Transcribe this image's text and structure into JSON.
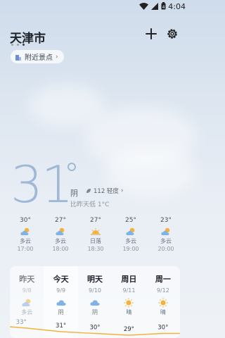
{
  "status": {
    "time": "4:04",
    "battery": "4"
  },
  "header": {
    "city": "天津市",
    "nearby_label": "附近景点"
  },
  "current": {
    "temp": "31",
    "condition": "阴",
    "aqi_label": "112 轻度",
    "compare": "比昨天低 1°C"
  },
  "hourly": [
    {
      "temp": "30°",
      "cond": "多云",
      "time": "17:00",
      "icon": "partly-cloudy-icon"
    },
    {
      "temp": "27°",
      "cond": "多云",
      "time": "18:00",
      "icon": "partly-cloudy-icon"
    },
    {
      "temp": "27°",
      "cond": "日落",
      "time": "18:30",
      "icon": "sunset-icon"
    },
    {
      "temp": "25°",
      "cond": "多云",
      "time": "19:00",
      "icon": "partly-cloudy-icon"
    },
    {
      "temp": "23°",
      "cond": "多云",
      "time": "20:00",
      "icon": "partly-cloudy-icon"
    }
  ],
  "daily": [
    {
      "name": "昨天",
      "date": "9/8",
      "cond": "多云",
      "hi": "33°",
      "icon": "partly-cloudy-icon"
    },
    {
      "name": "今天",
      "date": "9/9",
      "cond": "阴",
      "hi": "31°",
      "icon": "cloud-icon"
    },
    {
      "name": "明天",
      "date": "9/10",
      "cond": "阴",
      "hi": "30°",
      "icon": "cloud-icon"
    },
    {
      "name": "周日",
      "date": "9/11",
      "cond": "晴",
      "hi": "29°",
      "icon": "sun-icon"
    },
    {
      "name": "周一",
      "date": "9/12",
      "cond": "晴",
      "hi": "30°",
      "icon": "sun-icon"
    }
  ],
  "colors": {
    "accent_temp": "#9fb8d6",
    "sun": "#f2b33d",
    "cloud": "#7fb3e3"
  }
}
